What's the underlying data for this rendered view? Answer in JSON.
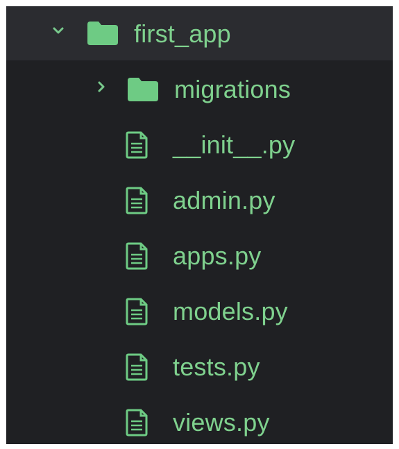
{
  "tree": {
    "root": {
      "label": "first_app",
      "icon": "folder-icon",
      "expanded": true
    },
    "children": [
      {
        "label": "migrations",
        "icon": "folder-icon",
        "type": "folder",
        "expanded": false
      },
      {
        "label": "__init__.py",
        "icon": "file-icon",
        "type": "file"
      },
      {
        "label": "admin.py",
        "icon": "file-icon",
        "type": "file"
      },
      {
        "label": "apps.py",
        "icon": "file-icon",
        "type": "file"
      },
      {
        "label": "models.py",
        "icon": "file-icon",
        "type": "file"
      },
      {
        "label": "tests.py",
        "icon": "file-icon",
        "type": "file"
      },
      {
        "label": "views.py",
        "icon": "file-icon",
        "type": "file"
      }
    ],
    "colors": {
      "background": "#1f2023",
      "selected_row": "#2b2c30",
      "accent": "#7fd18e",
      "folder": "#6ecb84"
    }
  }
}
